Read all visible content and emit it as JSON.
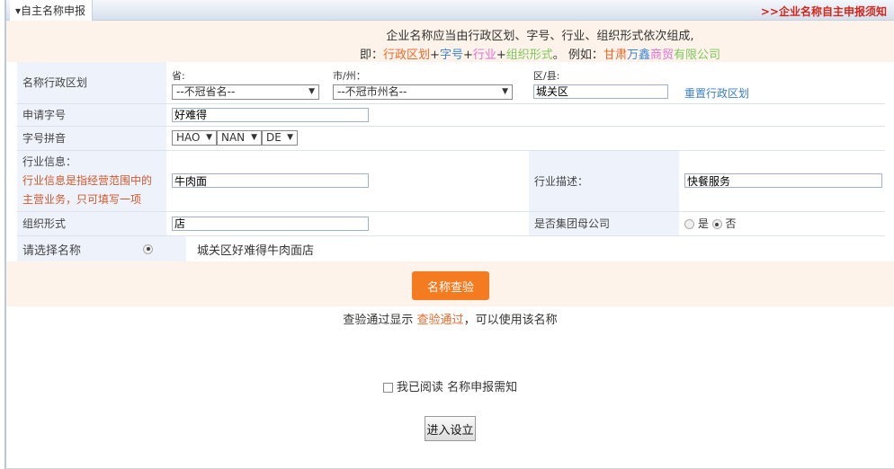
{
  "header": {
    "tab": "▾自主名称申报",
    "notice_link": ">>企业名称自主申报须知"
  },
  "intro": {
    "line1": "企业名称应当由行政区划、字号、行业、组织形式依次组成,",
    "prefix": "即：",
    "p1": "行政区划",
    "plus": "+",
    "p2": "字号",
    "p3": "行业",
    "p4": "组织形式",
    "sep": "。 例如：",
    "e1": "甘肃",
    "e2": "万鑫",
    "e3": "商贸",
    "e4": "有限公司"
  },
  "form": {
    "region": {
      "label": "名称行政区划",
      "province_label": "省:",
      "province_value": "--不冠省名--",
      "city_label": "市/州：",
      "city_value": "--不冠市州名--",
      "district_label": "区/县:",
      "district_value": "城关区",
      "reset": "重置行政区划"
    },
    "brand": {
      "label": "申请字号",
      "value": "好难得"
    },
    "pinyin": {
      "label": "字号拼音",
      "values": [
        "HAO",
        "NAN",
        "DE"
      ]
    },
    "industry": {
      "label": "行业信息：",
      "hint1": "行业信息是指经营范围中的",
      "hint2": "主营业务，只可填写一项",
      "value": "牛肉面",
      "desc_label": "行业描述：",
      "desc_value": "快餐服务"
    },
    "org": {
      "label": "组织形式",
      "value": "店",
      "group_label": "是否集团母公司",
      "yes": "是",
      "no": "否",
      "selected": "否"
    },
    "choose": {
      "label": "请选择名称",
      "name": "城关区好难得牛肉面店"
    }
  },
  "check_button": "名称查验",
  "check_hint": {
    "a": "查验通过显示 ",
    "b": "查验通过",
    "c": "，可以使用该名称"
  },
  "agree": {
    "a": "我已阅读 ",
    "b": "名称申报需知",
    "checked": false
  },
  "enter_button": "进入设立"
}
